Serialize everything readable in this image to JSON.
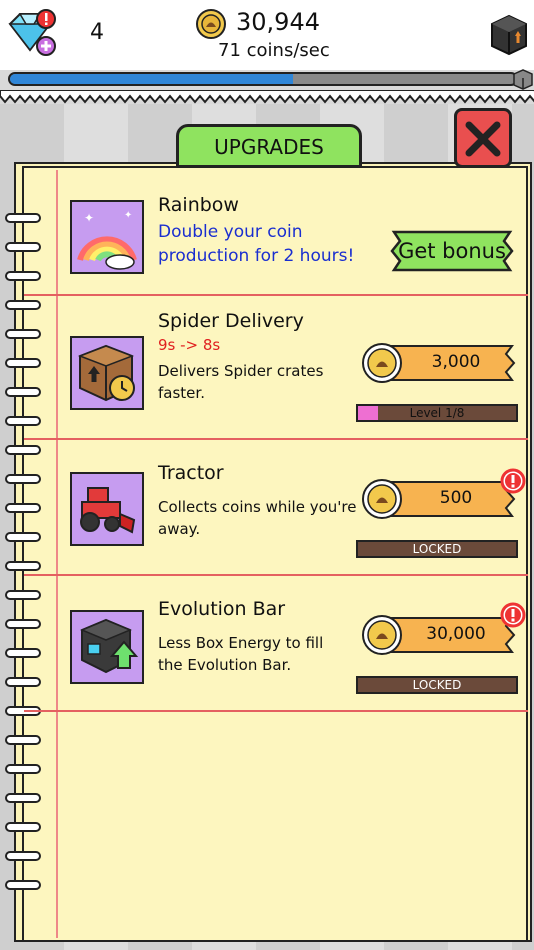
{
  "header": {
    "gem_count": "4",
    "coins_total": "30,944",
    "coins_rate": "71 coins/sec",
    "evolution_progress": 0.56
  },
  "panel": {
    "tab_label": "UPGRADES",
    "close_label": "X"
  },
  "upgrades": [
    {
      "title": "Rainbow",
      "description": "Double your coin production for 2 hours!",
      "button_label": "Get bonus"
    },
    {
      "title": "Spider Delivery",
      "change": "9s -> 8s",
      "description": "Delivers Spider crates faster.",
      "price": "3,000",
      "level_label": "Level 1/8",
      "level_fraction": 0.125
    },
    {
      "title": "Tractor",
      "description": "Collects coins while you're away.",
      "price": "500",
      "status": "LOCKED"
    },
    {
      "title": "Evolution Bar",
      "description": "Less Box Energy to fill the Evolution Bar.",
      "price": "30,000",
      "status": "LOCKED"
    }
  ],
  "colors": {
    "accent_green": "#8fe35f",
    "close_red": "#e94f4f",
    "price_orange": "#f7b350",
    "locked_brown": "#6b4a3a",
    "progress_blue": "#2f86d8",
    "level_pink": "#ee6fd2",
    "paper": "#fdf6bf",
    "rule_red": "#e46060"
  },
  "icons": [
    "diamond-icon",
    "alert-icon",
    "plus-icon",
    "coin-icon",
    "crate-icon",
    "close-icon",
    "rainbow-icon",
    "spider-crate-icon",
    "tractor-icon",
    "evolution-box-icon"
  ]
}
